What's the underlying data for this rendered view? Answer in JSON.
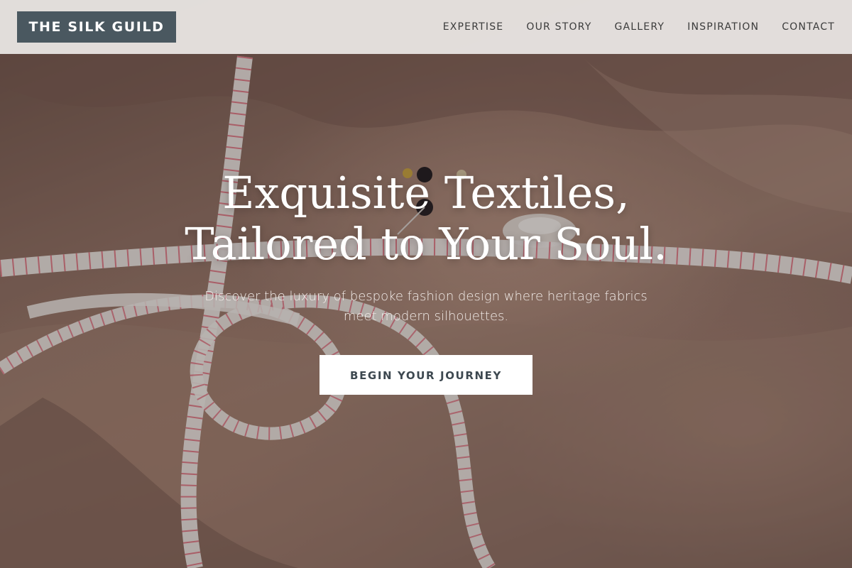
{
  "site": {
    "logo": "THE SILK GUILD"
  },
  "nav": {
    "items": [
      {
        "label": "EXPERTISE"
      },
      {
        "label": "OUR STORY"
      },
      {
        "label": "GALLERY"
      },
      {
        "label": "INSPIRATION"
      },
      {
        "label": "CONTACT"
      }
    ]
  },
  "hero": {
    "headline_line1": "Exquisite Textiles,",
    "headline_line2": "Tailored to Your Soul.",
    "subtitle": "Discover the luxury of bespoke fashion design where heritage fabrics meet modern silhouettes.",
    "cta_label": "BEGIN YOUR JOURNEY",
    "image_subject": "silk fabric with measuring tape, pins and thread spool"
  },
  "colors": {
    "logo_bg": "#4a5860",
    "header_bg": "#ece8e6",
    "cta_bg": "#ffffff",
    "cta_text": "#3d4850",
    "fabric": "#9c7a6a",
    "tape": "#f3ede8",
    "tape_marks": "#d9334a"
  }
}
